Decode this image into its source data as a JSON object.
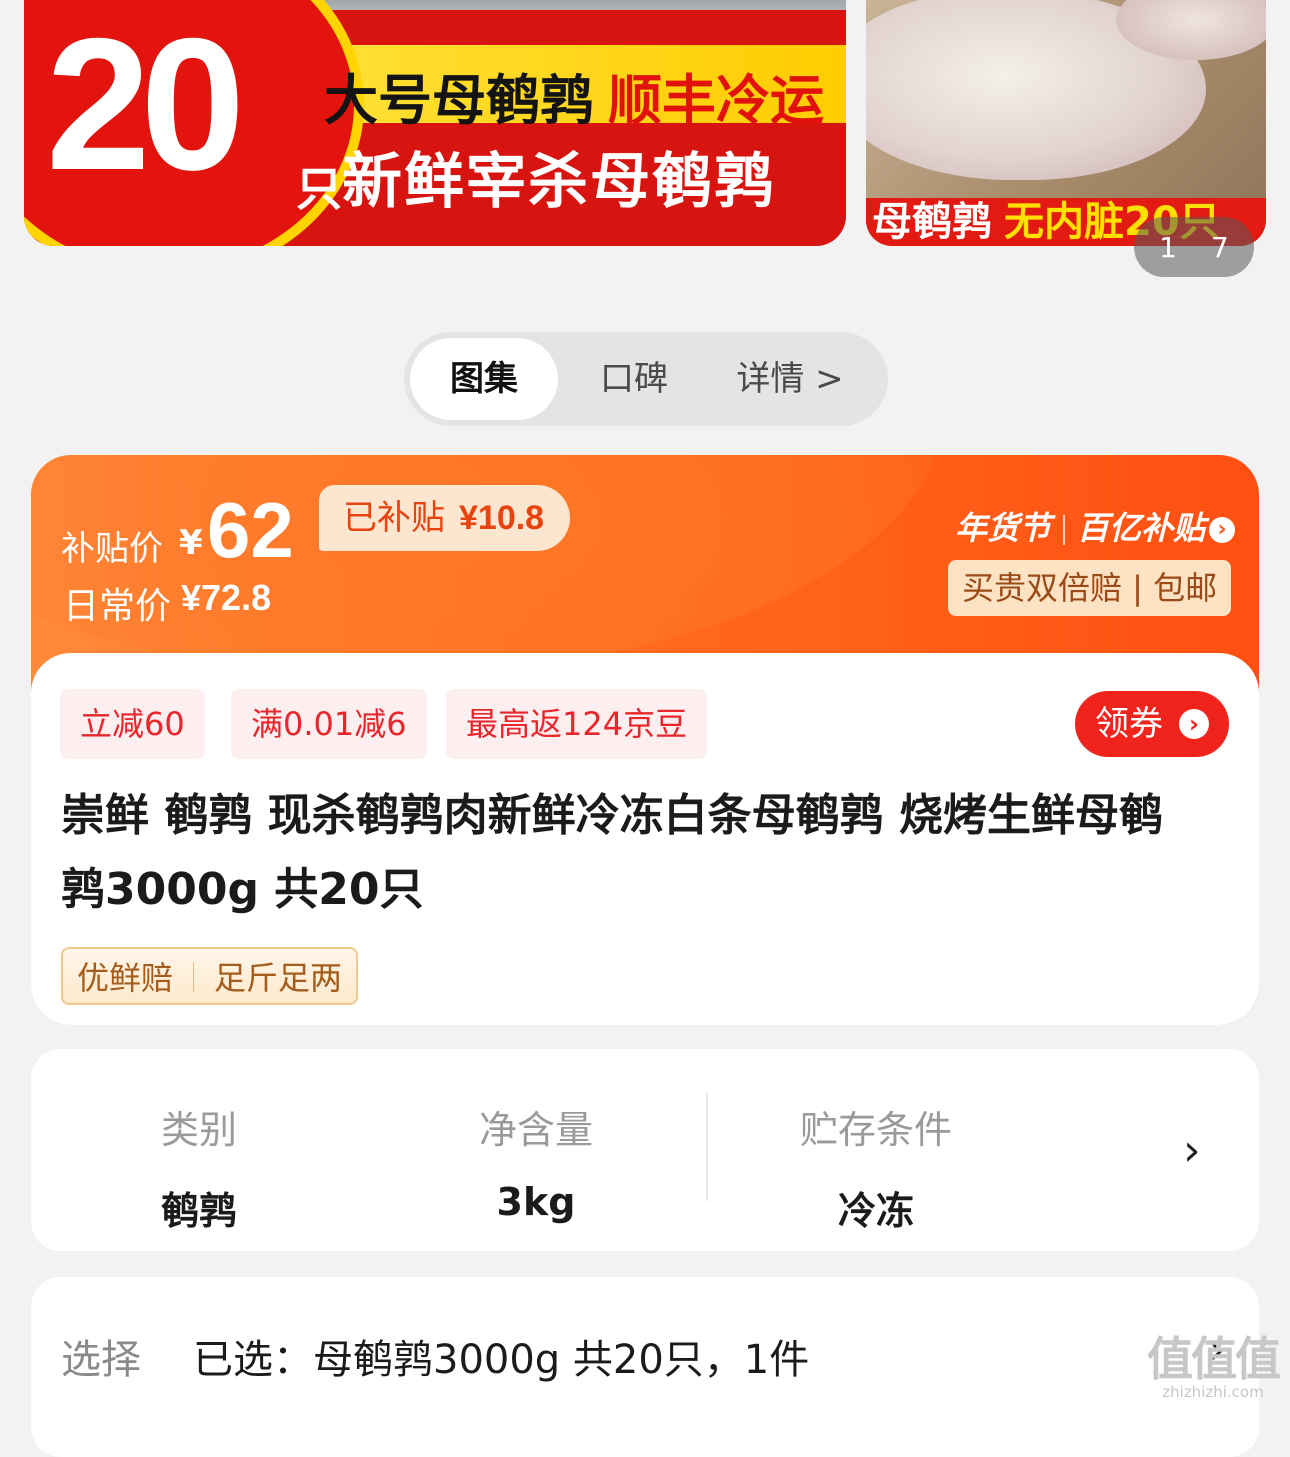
{
  "carousel": {
    "main_banner": {
      "big_number": "20",
      "big_unit": "只",
      "line1_black": "大号母鹌鹑",
      "line1_red": "顺丰冷运",
      "line2": "新鲜宰杀母鹌鹑"
    },
    "side_banner": {
      "caption_white": "母鹌鹑",
      "caption_yellow": "无内脏20只"
    },
    "page_current": "1",
    "page_total": "7"
  },
  "tabs": {
    "gallery": "图集",
    "reviews": "口碑",
    "details": "详情 >"
  },
  "price": {
    "subsidy_label": "补贴价",
    "currency": "¥",
    "subsidy_price": "62",
    "subsidized_label": "已补贴",
    "subsidized_amount": "¥10.8",
    "daily_label": "日常价",
    "daily_price": "¥72.8",
    "event_name": "年货节",
    "program_name": "百亿补贴",
    "promise": "买贵双倍赔 | 包邮",
    "colors": {
      "accent": "#ff5a14",
      "coupon_red": "#e8262b"
    }
  },
  "coupons": [
    "立减60",
    "满0.01减6",
    "最高返124京豆"
  ],
  "claim_button": "领券",
  "product": {
    "title": "崇鲜 鹌鹑 现杀鹌鹑肉新鲜冷冻白条母鹌鹑 烧烤生鲜母鹌鹑3000g 共20只",
    "tags": [
      "优鲜赔",
      "足斤足两"
    ]
  },
  "specs": [
    {
      "label": "类别",
      "value": "鹌鹑"
    },
    {
      "label": "净含量",
      "value": "3kg"
    },
    {
      "label": "贮存条件",
      "value": "冷冻"
    }
  ],
  "selection": {
    "label": "选择",
    "value": "已选：母鹌鹑3000g 共20只，1件"
  },
  "watermark": {
    "logo": "值值值",
    "url": "zhizhizhi.com"
  },
  "icons": {
    "specs_more": "chevron-right-icon",
    "selection_more": "chevron-right-icon",
    "claim_arrow": "arrow-circle-right-icon"
  }
}
